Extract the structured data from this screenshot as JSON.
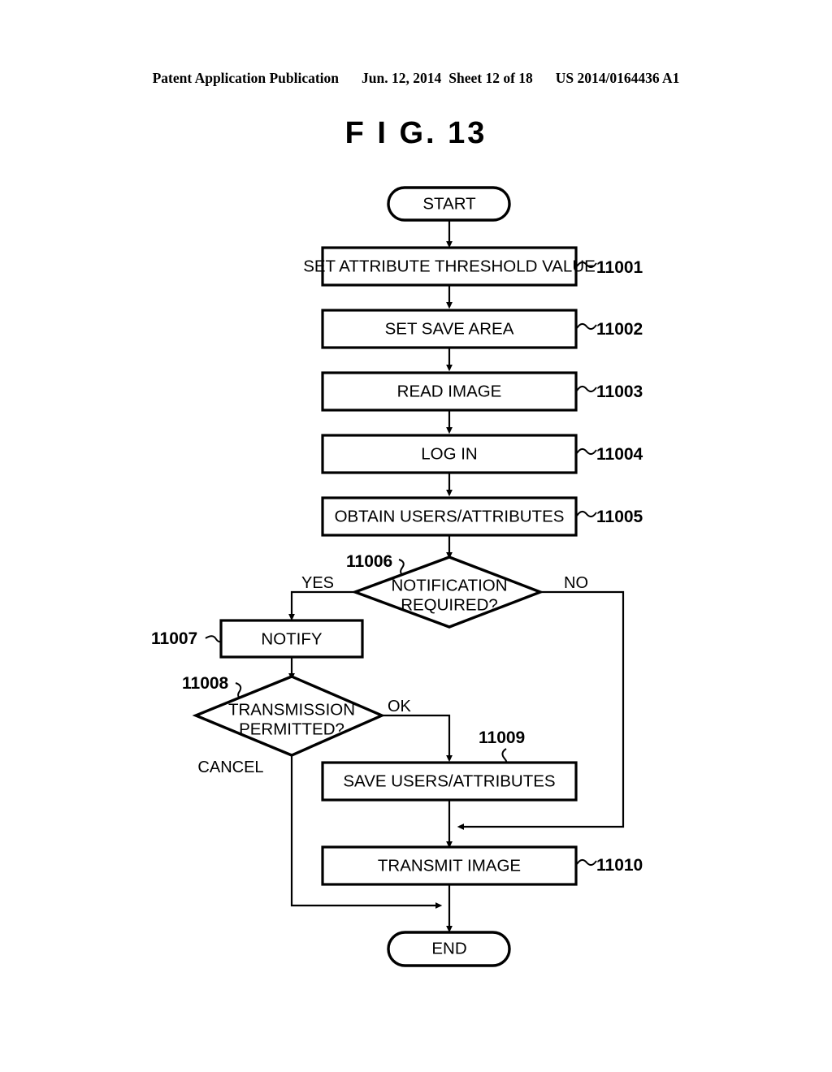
{
  "header": {
    "publication": "Patent Application Publication",
    "date": "Jun. 12, 2014",
    "sheet": "Sheet 12 of 18",
    "patent_number": "US 2014/0164436 A1"
  },
  "figure": {
    "title": "F I G.  13"
  },
  "flowchart": {
    "nodes": {
      "start": "START",
      "step_11001": "SET ATTRIBUTE THRESHOLD VALUE",
      "step_11002": "SET SAVE AREA",
      "step_11003": "READ IMAGE",
      "step_11004": "LOG IN",
      "step_11005": "OBTAIN USERS/ATTRIBUTES",
      "decision_11006_line1": "NOTIFICATION",
      "decision_11006_line2": "REQUIRED?",
      "step_11007": "NOTIFY",
      "decision_11008_line1": "TRANSMISSION",
      "decision_11008_line2": "PERMITTED?",
      "step_11009": "SAVE USERS/ATTRIBUTES",
      "step_11010": "TRANSMIT IMAGE",
      "end": "END"
    },
    "ref_numbers": {
      "r11001": "11001",
      "r11002": "11002",
      "r11003": "11003",
      "r11004": "11004",
      "r11005": "11005",
      "r11006": "11006",
      "r11007": "11007",
      "r11008": "11008",
      "r11009": "11009",
      "r11010": "11010"
    },
    "branch_labels": {
      "yes": "YES",
      "no": "NO",
      "ok": "OK",
      "cancel": "CANCEL"
    },
    "colors": {
      "stroke": "#000000",
      "fill": "#ffffff"
    }
  }
}
